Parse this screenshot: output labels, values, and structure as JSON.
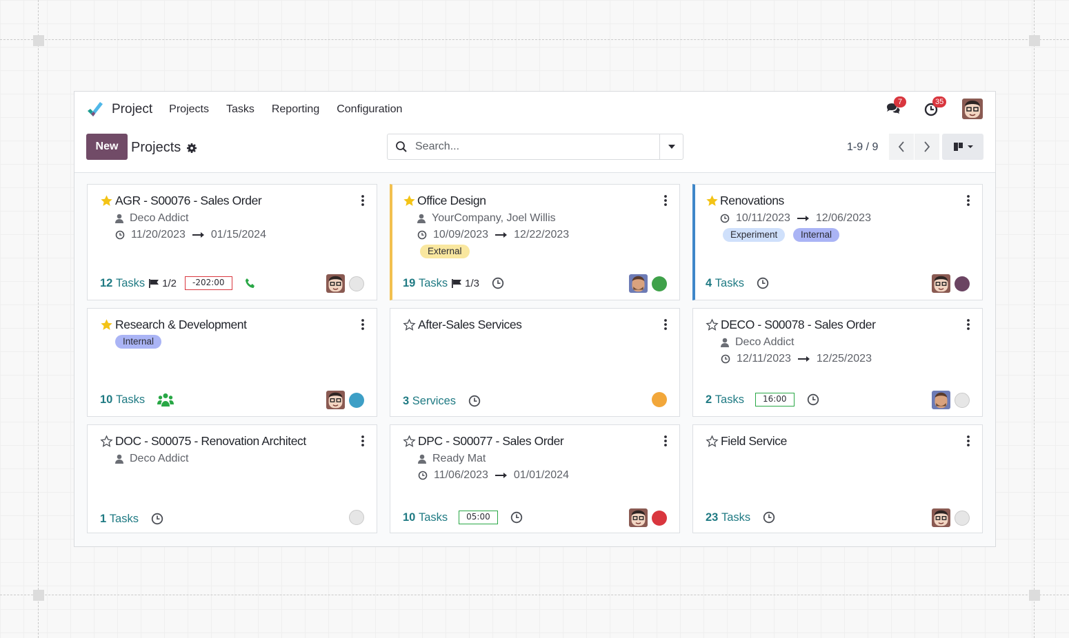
{
  "app": {
    "brand": "Project",
    "menu": [
      "Projects",
      "Tasks",
      "Reporting",
      "Configuration"
    ],
    "messages_badge": "7",
    "activities_badge": "35"
  },
  "control_panel": {
    "new_label": "New",
    "breadcrumb": "Projects",
    "search_placeholder": "Search...",
    "pager": "1-9 / 9"
  },
  "colors": {
    "brand": "#714b67",
    "count_link": "#1f7a83",
    "badge": "#d9363e",
    "card_yellow": "#f2c04f",
    "card_blue": "#3f87c9",
    "status_green": "#3fa14a",
    "status_blue": "#3d9fc6",
    "status_orange": "#f2a73a",
    "status_red": "#d9363e",
    "status_purple": "#6b4462",
    "status_gray": "#e1e1e1"
  },
  "projects": [
    {
      "title": "AGR - S00076 - Sales Order",
      "favorite": true,
      "customer": "Deco Addict",
      "date_start": "11/20/2023",
      "date_end": "01/15/2024",
      "count_num": "12",
      "count_label": "Tasks",
      "milestone": "1/2",
      "hours": "-202:00",
      "footer_icon": "phone-icon",
      "status": "gray"
    },
    {
      "title": "Office Design",
      "favorite": true,
      "customer": "YourCompany, Joel Willis",
      "date_start": "10/09/2023",
      "date_end": "12/22/2023",
      "tags": [
        "External"
      ],
      "count_num": "19",
      "count_label": "Tasks",
      "milestone": "1/3",
      "footer_icon": "clock-icon",
      "status": "green"
    },
    {
      "title": "Renovations",
      "favorite": true,
      "date_start": "10/11/2023",
      "date_end": "12/06/2023",
      "tags": [
        "Experiment",
        "Internal"
      ],
      "count_num": "4",
      "count_label": "Tasks",
      "footer_icon": "clock-icon",
      "status": "purple"
    },
    {
      "title": "Research & Development",
      "favorite": true,
      "tags": [
        "Internal"
      ],
      "count_num": "10",
      "count_label": "Tasks",
      "footer_icon": "users-icon",
      "status": "blue"
    },
    {
      "title": "After-Sales Services",
      "favorite": false,
      "count_num": "3",
      "count_label": "Services",
      "footer_icon": "clock-icon",
      "status": "orange"
    },
    {
      "title": "DECO - S00078 - Sales Order",
      "favorite": false,
      "customer": "Deco Addict",
      "date_start": "12/11/2023",
      "date_end": "12/25/2023",
      "count_num": "2",
      "count_label": "Tasks",
      "hours": "16:00",
      "footer_icon": "clock-icon",
      "status": "gray"
    },
    {
      "title": "DOC - S00075 - Renovation Architect",
      "favorite": false,
      "customer": "Deco Addict",
      "count_num": "1",
      "count_label": "Tasks",
      "footer_icon": "clock-icon",
      "status": "gray"
    },
    {
      "title": "DPC - S00077 - Sales Order",
      "favorite": false,
      "customer": "Ready Mat",
      "date_start": "11/06/2023",
      "date_end": "01/01/2024",
      "count_num": "10",
      "count_label": "Tasks",
      "hours": "05:00",
      "footer_icon": "clock-icon",
      "status": "red"
    },
    {
      "title": "Field Service",
      "favorite": false,
      "count_num": "23",
      "count_label": "Tasks",
      "footer_icon": "clock-icon",
      "status": "gray"
    }
  ]
}
